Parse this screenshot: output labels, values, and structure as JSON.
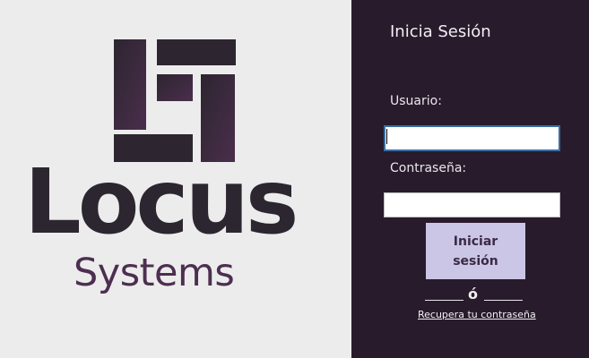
{
  "brand": {
    "logo_word": "Locus",
    "logo_sub": "Systems",
    "colors": {
      "panel_bg": "#ececec",
      "word": "#2c2630",
      "mark": "#2d2530",
      "mark_gradient": "#4a2e4c",
      "sub": "#4c2f50"
    }
  },
  "login": {
    "title": "Inicia Sesión",
    "user_label": "Usuario:",
    "user_value": "",
    "password_label": "Contraseña:",
    "password_value": "",
    "submit_label": "Iniciar sesión",
    "divider_text": "ó",
    "recover_link": "Recupera tu contraseña",
    "colors": {
      "panel_bg": "#281c2c",
      "button_bg": "#cbc5e6",
      "button_text": "#3a2a44",
      "focus_border": "#3a6ea5"
    }
  }
}
